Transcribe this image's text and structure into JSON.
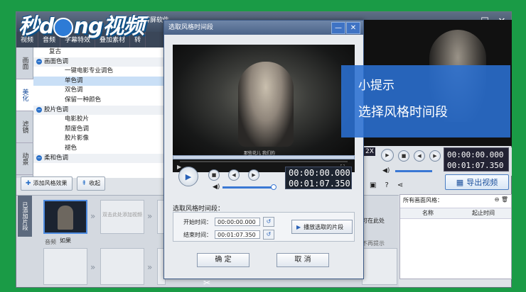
{
  "logo": {
    "text_a": "秒",
    "text_b": "d",
    "text_c": "ng视频"
  },
  "app": {
    "title": "屏软件",
    "title_prefix": "录屏",
    "tabs": [
      "视频",
      "音频",
      "字幕特效",
      "叠加素材",
      "转"
    ],
    "side_tabs": [
      "画面",
      "美化",
      "滤镜",
      "动景"
    ],
    "effects": [
      {
        "label": "复古",
        "kind": "item"
      },
      {
        "label": "画面色调",
        "kind": "group"
      },
      {
        "label": "一键电影专业调色",
        "kind": "item"
      },
      {
        "label": "单色调",
        "kind": "item",
        "selected": true
      },
      {
        "label": "双色调",
        "kind": "item"
      },
      {
        "label": "保留一种颜色",
        "kind": "item"
      },
      {
        "label": "胶片色调",
        "kind": "group"
      },
      {
        "label": "电影胶片",
        "kind": "item"
      },
      {
        "label": "颓废色调",
        "kind": "item"
      },
      {
        "label": "胶片影像",
        "kind": "item"
      },
      {
        "label": "褪色",
        "kind": "item"
      },
      {
        "label": "柔和色调",
        "kind": "group"
      }
    ],
    "add_effect_label": "添加风格效果",
    "collapse_label": "收起",
    "added_strip_label": "已添加片段",
    "slot_placeholder": "双击此处添加视频",
    "clip_label": "如果",
    "audio_label": "音频",
    "right_hint_a": "可在此处",
    "right_hint_b": "不再提示",
    "export_label": "导出视频",
    "speed_label": "2X",
    "right_time_current": "00:00:00.000",
    "right_time_total": "00:01:07.350",
    "right_list_title": "所有画面风格：",
    "right_list_col_name": "名称",
    "right_list_col_time": "起止时间"
  },
  "dialog": {
    "title": "选取风格时间段",
    "minimize": "—",
    "close": "✕",
    "time_current": "00:00:00.000",
    "time_total": "00:01:07.350",
    "subtitle": "那些花儿 我们的",
    "section_label": "选取风格时间段：",
    "start_label": "开始时间：",
    "start_value": "00:00:00.000",
    "end_label": "结束时间：",
    "end_value": "00:01:07.350",
    "play_segment_label": "播放选取的片段",
    "ok_label": "确 定",
    "cancel_label": "取 消"
  },
  "tip": {
    "line1": "小提示",
    "line2": "选择风格时间段"
  },
  "colors": {
    "green": "#1a9b46",
    "tip_blue": "#2a70d2",
    "title_bar": "#4b6388"
  }
}
